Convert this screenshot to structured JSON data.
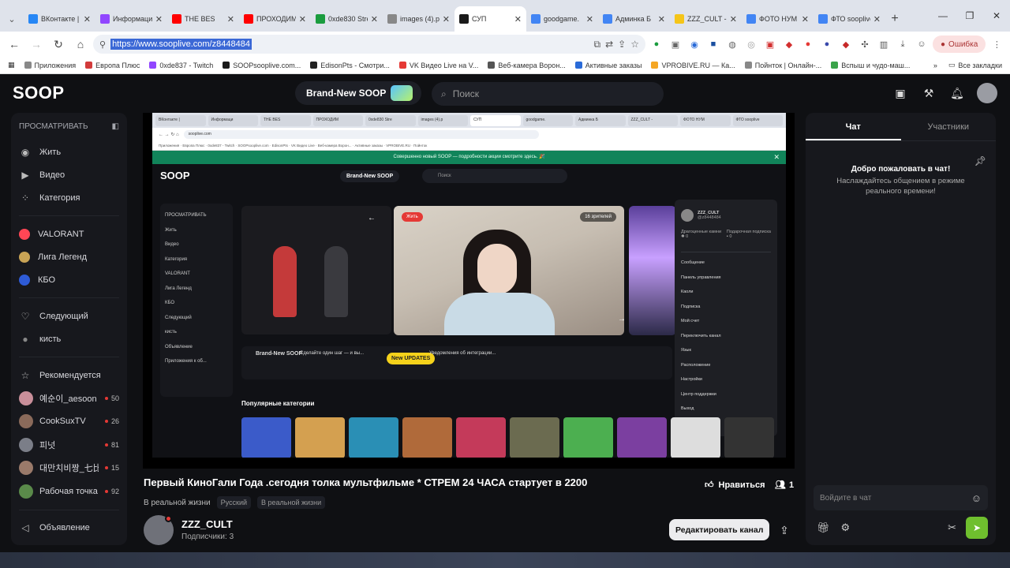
{
  "browser": {
    "tabs": [
      {
        "label": "ВКонтакте |",
        "color": "#2787f5"
      },
      {
        "label": "Информаци",
        "color": "#9146ff"
      },
      {
        "label": "THE BES",
        "color": "#ff0000"
      },
      {
        "label": "ПРОХОДИМ",
        "color": "#ff0000"
      },
      {
        "label": "0xde830 Stre",
        "color": "#1a9c3e"
      },
      {
        "label": "images (4).p",
        "color": "#888888"
      },
      {
        "label": "СУП",
        "color": "#1a1a1a",
        "active": true
      },
      {
        "label": "goodgame.",
        "color": "#4285f4"
      },
      {
        "label": "Админка Б",
        "color": "#4285f4"
      },
      {
        "label": "ZZZ_CULT -",
        "color": "#f5c518"
      },
      {
        "label": "ФОТО НУМ",
        "color": "#4285f4"
      },
      {
        "label": "ФТО sooplive",
        "color": "#4285f4"
      }
    ],
    "url": "https://www.sooplive.com/z8448484",
    "error_label": "Ошибка",
    "bookmarks": [
      {
        "label": "Приложения",
        "color": "#888888"
      },
      {
        "label": "Европа Плюс",
        "color": "#d23b3b"
      },
      {
        "label": "0xde837 - Twitch",
        "color": "#9146ff"
      },
      {
        "label": "SOOPsooplive.com...",
        "color": "#1a1a1a"
      },
      {
        "label": "EdisonPts - Смотри...",
        "color": "#222222"
      },
      {
        "label": "VK Видео Live на V...",
        "color": "#e53935"
      },
      {
        "label": "Веб-камера Ворон...",
        "color": "#555555"
      },
      {
        "label": "Активные заказы",
        "color": "#2a6bd8"
      },
      {
        "label": "VPROBIVE.RU — Ка...",
        "color": "#f5a623"
      },
      {
        "label": "Пойнток | Онлайн-...",
        "color": "#888888"
      },
      {
        "label": "Вспыш и чудо-маш...",
        "color": "#3aa34a"
      }
    ],
    "bookmarks_all": "Все закладки"
  },
  "soop": {
    "logo": "SOOP",
    "brand_new": "Brand-New SOOP",
    "search_placeholder": "Поиск",
    "sidebar": {
      "header": "ПРОСМАТРИВАТЬ",
      "nav": [
        {
          "label": "Жить"
        },
        {
          "label": "Видео"
        },
        {
          "label": "Категория"
        }
      ],
      "games": [
        {
          "label": "VALORANT",
          "color": "#ff4655"
        },
        {
          "label": "Лига Легенд",
          "color": "#c8a355"
        },
        {
          "label": "КБО",
          "color": "#2e5bd6"
        }
      ],
      "following_label": "Следующий",
      "following_user": "кисть",
      "recommended_label": "Рекомендуется",
      "recommended": [
        {
          "name": "예순이_aesoon",
          "count": "50"
        },
        {
          "name": "CookSuxTV",
          "count": "26"
        },
        {
          "name": "피넛",
          "count": "81"
        },
        {
          "name": "대만치비짱_七比",
          "count": "15"
        },
        {
          "name": "Рабочая точка",
          "count": "92"
        }
      ],
      "announcement": "Объявление"
    },
    "stream": {
      "title": "Первый КиноГали Года .сегодня толка мультфильме * СТРЕМ 24 ЧАСА стартует в 2200",
      "like_label": "Нравиться",
      "viewers": "1",
      "category": "В реальной жизни",
      "tags": [
        "Русский",
        "В реальной жизни"
      ],
      "channel_name": "ZZZ_CULT",
      "subscribers": "Подписчики: 3",
      "edit_button": "Редактировать канал"
    },
    "chat": {
      "tab_chat": "Чат",
      "tab_participants": "Участники",
      "welcome": "Добро пожаловать в чат!",
      "welcome_sub": "Наслаждайтесь общением в режиме реального времени!",
      "input_placeholder": "Войдите в чат"
    },
    "inner": {
      "notice": "Совершенно новый SOOP — подробности акции смотрите здесь. 🎉",
      "logo": "SOOP",
      "brand_new": "Brand-New SOOP",
      "search": "Поиск",
      "url": "sooplive.com",
      "side": [
        "ПРОСМАТРИВАТЬ",
        "Жить",
        "Видео",
        "Категория",
        "VALORANT",
        "Лига Легенд",
        "КБО",
        "Следующий",
        "кисть",
        "Объявление",
        "Приложения к об..."
      ],
      "live_badge": "Жить",
      "viewers_badge": "16 зрителей",
      "menu_user": "ZZZ_CULT",
      "menu_handle": "@z8448484",
      "menu_donation_label": "Драгоценные камни",
      "menu_donation_value": "0",
      "menu_sub_label": "Подарочная подписка",
      "menu_sub_value": "0",
      "menu_items": [
        "Сообщение",
        "Панель управления",
        "Каоли",
        "Подписка",
        "Мой счет",
        "Переключить канал",
        "Язык",
        "Расположение",
        "Настройки",
        "Центр поддержки",
        "Выход"
      ],
      "banner_title": "Brand-New SOOP",
      "banner_text1": "Сделайте один шаг — и вы...",
      "banner_badge": "New UPDATES",
      "banner_text2": "Уведомления об интеграции...",
      "popular": "Популярные категории",
      "categories": [
        "#3b5bc9",
        "#d4a050",
        "#2a8fb5",
        "#b06a3a",
        "#c43a5a",
        "#6b6b50",
        "#4caf50",
        "#7b3fa0",
        "#dddddd",
        "#333333"
      ]
    }
  }
}
